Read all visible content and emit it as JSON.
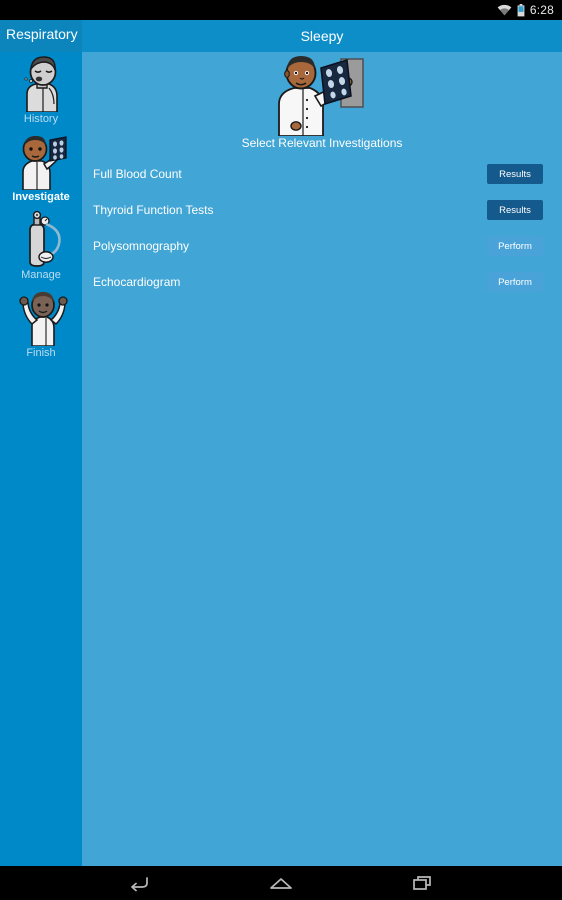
{
  "status_bar": {
    "time": "6:28",
    "wifi_icon": "wifi-icon",
    "battery_icon": "battery-icon"
  },
  "action_bar": {
    "section_label": "Respiratory",
    "title": "Sleepy"
  },
  "sidebar": {
    "items": [
      {
        "label": "History",
        "icon": "patient-coughing-icon",
        "active": false
      },
      {
        "label": "Investigate",
        "icon": "doctor-xray-icon",
        "active": true
      },
      {
        "label": "Manage",
        "icon": "oxygen-cylinder-icon",
        "active": false
      },
      {
        "label": "Finish",
        "icon": "person-arms-raised-icon",
        "active": false
      }
    ]
  },
  "main": {
    "hero_icon": "doctor-holding-xray-icon",
    "hero_caption": "Select Relevant Investigations",
    "investigations": [
      {
        "name": "Full Blood Count",
        "action": "Results"
      },
      {
        "name": "Thyroid Function Tests",
        "action": "Results"
      },
      {
        "name": "Polysomnography",
        "action": "Perform"
      },
      {
        "name": "Echocardiogram",
        "action": "Perform"
      }
    ]
  },
  "nav_bar": {
    "buttons": [
      {
        "name": "back-icon"
      },
      {
        "name": "home-icon"
      },
      {
        "name": "recents-icon"
      }
    ]
  },
  "colors": {
    "action_bar": "#0d8ec9",
    "action_bar_left": "#0c85bd",
    "sidebar": "#0089c8",
    "content": "#41a5d5",
    "results_button": "#155a8c",
    "perform_button": "#4aa3d8",
    "text": "#ffffff",
    "inactive_label": "#bcdcf0"
  }
}
